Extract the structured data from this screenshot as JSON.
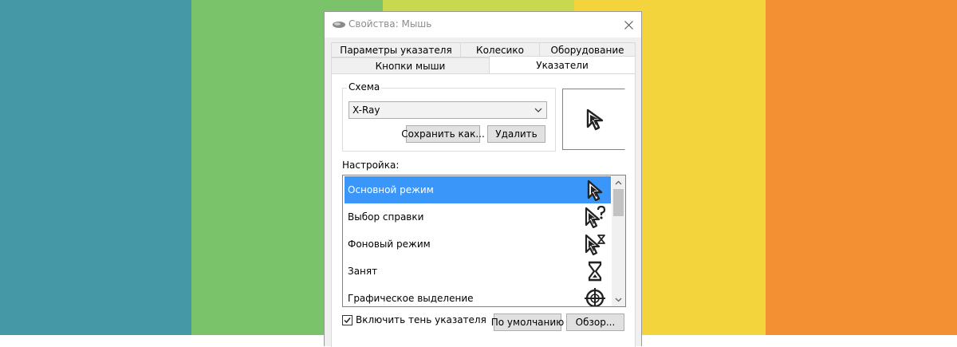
{
  "background": {
    "stripes": [
      "#4599a7",
      "#7ac36a",
      "#c8d84f",
      "#f4d43c",
      "#f39034"
    ]
  },
  "window": {
    "title": "Свойства: Мышь",
    "title_icon": "mouse-icon",
    "close_icon": "close-icon"
  },
  "tabs": {
    "row1": [
      "Параметры указателя",
      "Колесико",
      "Оборудование"
    ],
    "row2": [
      "Кнопки мыши",
      "Указатели"
    ],
    "active": "Указатели"
  },
  "scheme": {
    "group_label": "Схема",
    "selected": "X-Ray",
    "save_as_label": "Сохранить как...",
    "delete_label": "Удалить"
  },
  "customize": {
    "label": "Настройка:",
    "items": [
      {
        "label": "Основной режим",
        "icon": "arrow-cursor-icon",
        "selected": true
      },
      {
        "label": "Выбор справки",
        "icon": "help-cursor-icon",
        "selected": false
      },
      {
        "label": "Фоновый режим",
        "icon": "working-in-background-cursor-icon",
        "selected": false
      },
      {
        "label": "Занят",
        "icon": "busy-hourglass-cursor-icon",
        "selected": false
      },
      {
        "label": "Графическое выделение",
        "icon": "crosshair-cursor-icon",
        "selected": false
      }
    ]
  },
  "options": {
    "shadow_label": "Включить тень указателя",
    "shadow_checked": true,
    "default_label": "По умолчанию",
    "browse_label": "Обзор..."
  }
}
